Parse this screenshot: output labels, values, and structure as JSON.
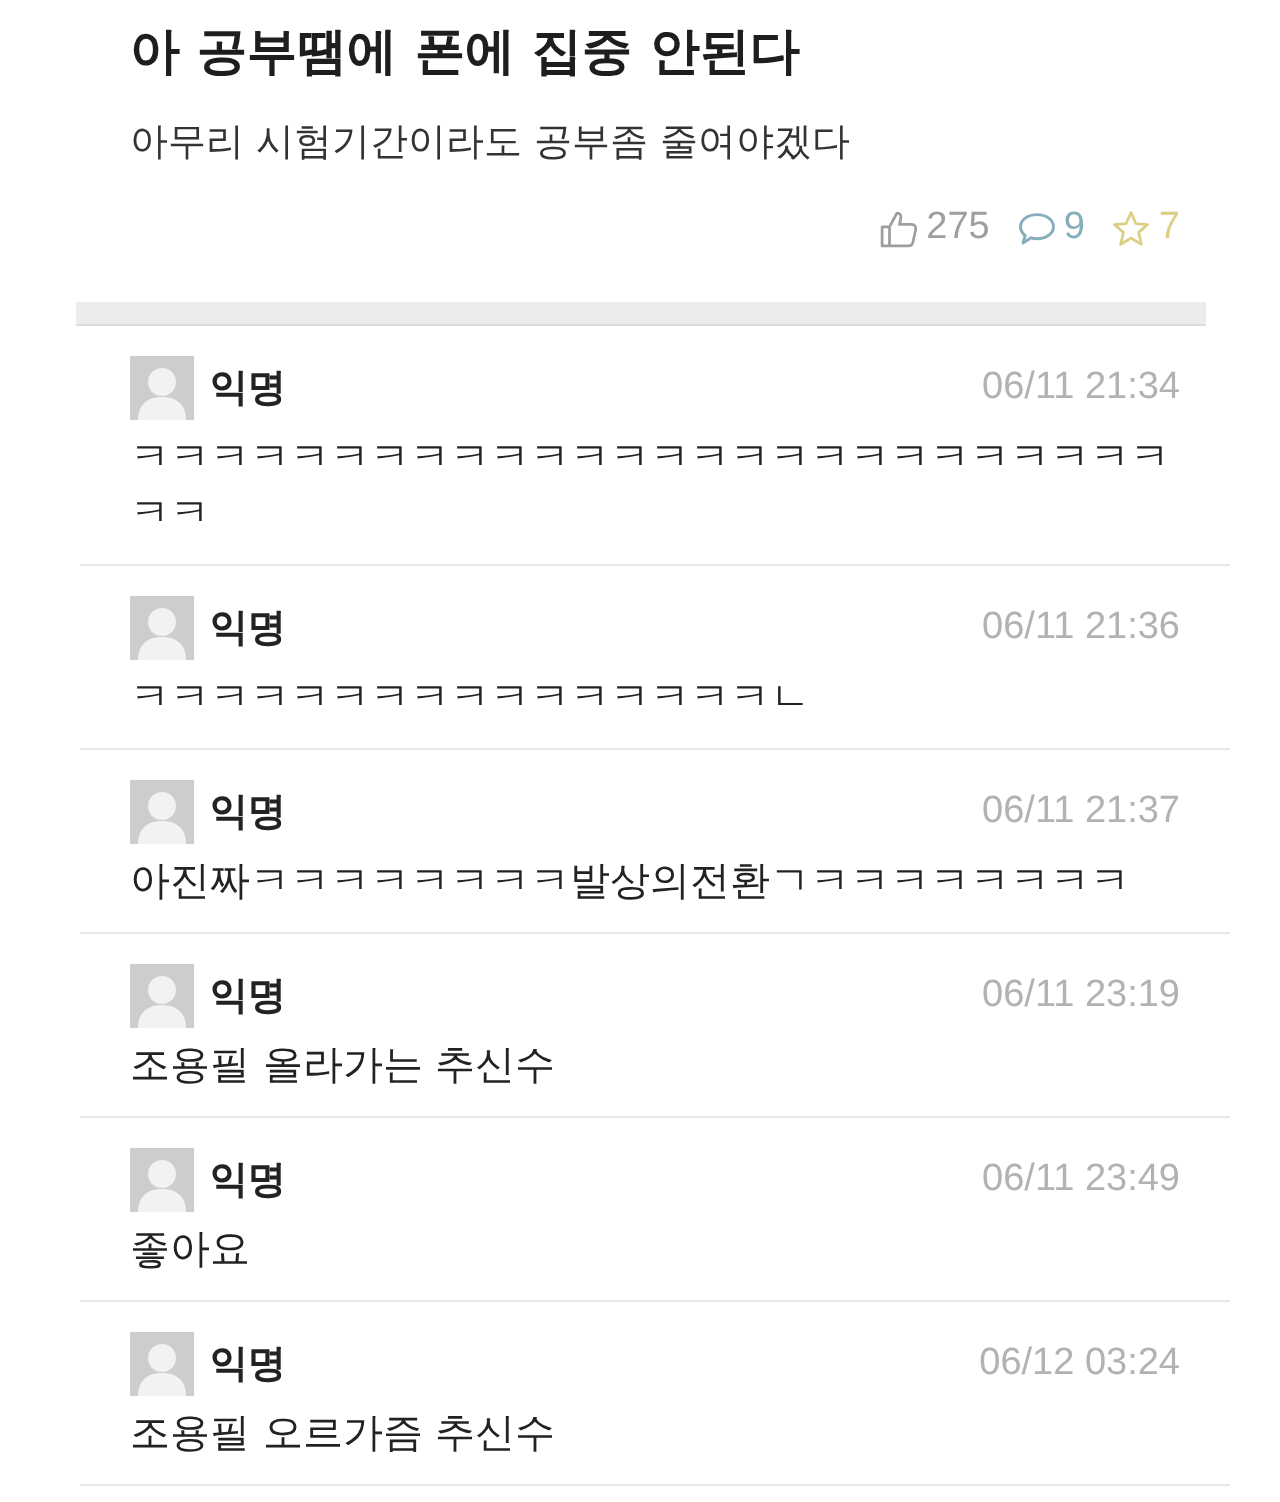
{
  "post": {
    "title": "아 공부땜에 폰에 집중 안된다",
    "body": "아무리 시험기간이라도 공부좀 줄여야겠다",
    "stats": [
      {
        "kind": "like",
        "count": "275",
        "color": "#9e9e9e"
      },
      {
        "kind": "comment",
        "count": "9",
        "color": "#86aebb"
      },
      {
        "kind": "star",
        "count": "7",
        "color": "#dccf85"
      }
    ]
  },
  "comments": [
    {
      "author": "익명",
      "time": "06/11 21:34",
      "text": "ㅋㅋㅋㅋㅋㅋㅋㅋㅋㅋㅋㅋㅋㅋㅋㅋㅋㅋㅋㅋㅋㅋㅋㅋㅋㅋㅋㅋ"
    },
    {
      "author": "익명",
      "time": "06/11 21:36",
      "text": "ㅋㅋㅋㅋㅋㅋㅋㅋㅋㅋㅋㅋㅋㅋㅋㅋㄴ"
    },
    {
      "author": "익명",
      "time": "06/11 21:37",
      "text": "아진짜ㅋㅋㅋㅋㅋㅋㅋㅋ발상의전환ㄱㅋㅋㅋㅋㅋㅋㅋㅋ"
    },
    {
      "author": "익명",
      "time": "06/11 23:19",
      "text": "조용필 올라가는 추신수"
    },
    {
      "author": "익명",
      "time": "06/11 23:49",
      "text": "좋아요"
    },
    {
      "author": "익명",
      "time": "06/12 03:24",
      "text": "조용필 오르가즘 추신수"
    }
  ]
}
